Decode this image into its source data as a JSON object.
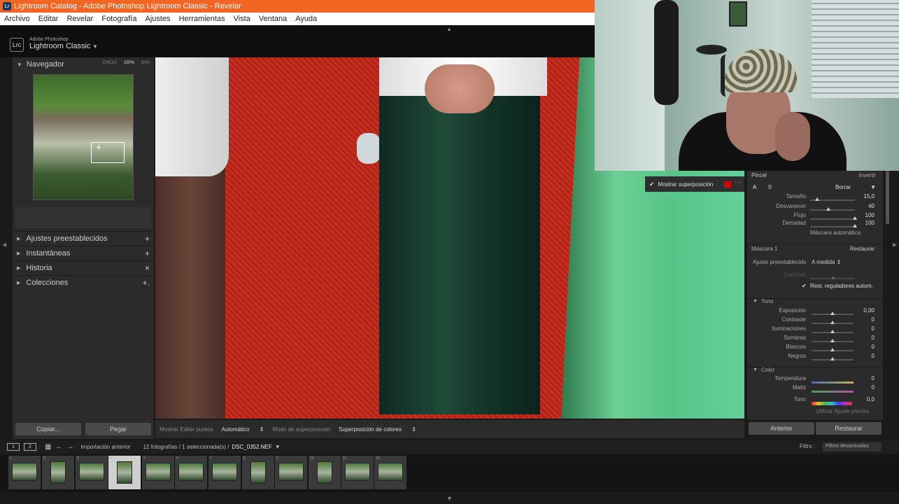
{
  "window": {
    "title": "Lightroom Catalog - Adobe Photoshop Lightroom Classic - Revelar",
    "app_icon_text": "Lr"
  },
  "menu": [
    "Archivo",
    "Editar",
    "Revelar",
    "Fotografía",
    "Ajustes",
    "Herramientas",
    "Vista",
    "Ventana",
    "Ayuda"
  ],
  "brand": {
    "small": "Adobe Photoshop",
    "big": "Lightroom Classic",
    "logo": "Lrc"
  },
  "navigator": {
    "title": "Navegador",
    "zoom": [
      "ENCAJ",
      "100%",
      "50%"
    ]
  },
  "left_sections": [
    {
      "label": "Ajustes preestablecidos",
      "action": "+"
    },
    {
      "label": "Instantáneas",
      "action": "+"
    },
    {
      "label": "Historia",
      "action": "×"
    },
    {
      "label": "Colecciones",
      "action": "+."
    }
  ],
  "left_buttons": {
    "copy": "Copiar...",
    "paste": "Pegar"
  },
  "photo_toolbar": {
    "show_pins": "Mostrar Editar puntos",
    "pins_value": "Automático",
    "overlay_mode": "Modo de superposición",
    "overlay_value": "Superposición de colores"
  },
  "overlay_box": {
    "label": "Mostrar superposición",
    "color": "#dd0000"
  },
  "brush": {
    "title": "Pincel",
    "invert": "Invertir",
    "a": "A",
    "b": "B",
    "erase": "Borrar",
    "rows": [
      {
        "label": "Tamaño",
        "value": "15,0",
        "pos": 0.15
      },
      {
        "label": "Desvanecer",
        "value": "40",
        "pos": 0.4
      },
      {
        "label": "Flujo",
        "value": "100",
        "pos": 1.0
      },
      {
        "label": "Densidad",
        "value": "100",
        "pos": 1.0
      }
    ],
    "auto_mask": "Máscara automática"
  },
  "mask": {
    "title": "Máscara 1",
    "reset": "Restaurar",
    "preset_label": "Ajuste preestablecido",
    "preset_value": "A medida",
    "amount_label": "Cantidad",
    "reset_sliders": "Rest. reguladores autom."
  },
  "tone": {
    "title": "Tono",
    "rows": [
      {
        "label": "Exposición",
        "value": "0,00"
      },
      {
        "label": "Contraste",
        "value": "0"
      },
      {
        "label": "Iluminaciones",
        "value": "0"
      },
      {
        "label": "Sombras",
        "value": "0"
      },
      {
        "label": "Blancos",
        "value": "0"
      },
      {
        "label": "Negros",
        "value": "0"
      }
    ]
  },
  "color": {
    "title": "Color",
    "temp": {
      "label": "Temperatura",
      "value": "0"
    },
    "tint": {
      "label": "Matiz",
      "value": "0"
    },
    "hue": {
      "label": "Tono",
      "value": "0,0"
    },
    "fine": "Utilizar Ajuste preciso"
  },
  "right_buttons": {
    "prev": "Anterior",
    "reset": "Restaurar"
  },
  "filmbar": {
    "mon1": "1",
    "mon2": "2",
    "source": "Importación anterior",
    "count": "12 fotografías / 1 seleccionada(s) /",
    "file": "DSC_0352.NEF",
    "filter_label": "Filtro :",
    "filter_value": "Filtros desactivados"
  },
  "thumbnails": [
    "1",
    "2",
    "3",
    "4",
    "5",
    "6",
    "7",
    "8",
    "9",
    "10",
    "11",
    "12"
  ]
}
